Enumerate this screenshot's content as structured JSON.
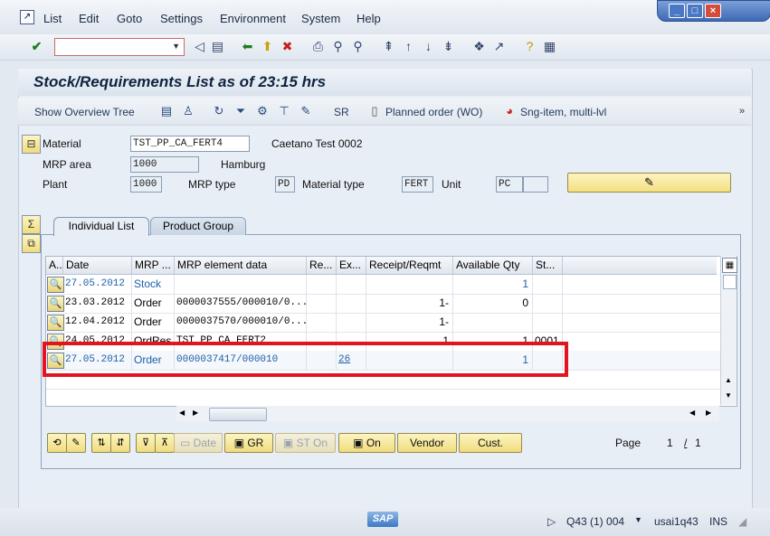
{
  "menu": [
    "List",
    "Edit",
    "Goto",
    "Settings",
    "Environment",
    "System",
    "Help"
  ],
  "menu_underline": [
    "L",
    "E",
    "G",
    "S",
    "n",
    "y",
    "H"
  ],
  "command_field": {
    "value": ""
  },
  "title": "Stock/Requirements List as of 23:15 hrs",
  "app_toolbar": {
    "show_overview": "Show Overview Tree",
    "sr": "SR",
    "planned_order": "Planned order (WO)",
    "sng_item": "Sng-item, multi-lvl"
  },
  "header": {
    "material_label": "Material",
    "material_value": "TST_PP_CA_FERT4",
    "material_desc": "Caetano Test 0002",
    "mrp_area_label": "MRP area",
    "mrp_area_value": "1000",
    "mrp_area_desc": "Hamburg",
    "plant_label": "Plant",
    "plant_value": "1000",
    "mrp_type_label": "MRP type",
    "mrp_type_value": "PD",
    "material_type_label": "Material type",
    "material_type_value": "FERT",
    "unit_label": "Unit",
    "unit_value": "PC",
    "unit_value2": ""
  },
  "tabs": [
    "Individual List",
    "Product Group"
  ],
  "columns": [
    "A..",
    "Date",
    "MRP ...",
    "MRP element data",
    "Re...",
    "Ex...",
    "Receipt/Reqmt",
    "Available Qty",
    "St..."
  ],
  "rows": [
    {
      "date": "27.05.2012",
      "mrp": "Stock",
      "element": "",
      "re": "",
      "ex": "",
      "receipt": "",
      "available": "1",
      "st": ""
    },
    {
      "date": "23.03.2012",
      "mrp": "Order",
      "element": "0000037555/000010/0...",
      "re": "",
      "ex": "",
      "receipt": "1-",
      "available": "0",
      "st": ""
    },
    {
      "date": "12.04.2012",
      "mrp": "Order",
      "element": "0000037570/000010/0...",
      "re": "",
      "ex": "",
      "receipt": "1-",
      "available": "",
      "st": ""
    },
    {
      "date": "24.05.2012",
      "mrp": "OrdRes",
      "element": "TST_PP_CA_FERT2",
      "re": "",
      "ex": "",
      "receipt": "1",
      "available": "1",
      "st": "0001"
    },
    {
      "date": "27.05.2012",
      "mrp": "Order",
      "element": "0000037417/000010",
      "re": "",
      "ex": "26",
      "receipt": "",
      "available": "1",
      "st": ""
    }
  ],
  "bottom_buttons": {
    "date": "Date",
    "gr": "GR",
    "st_on": "ST On",
    "on": "On",
    "vendor": "Vendor",
    "cust": "Cust."
  },
  "paging": {
    "label": "Page",
    "current": "1",
    "sep": "/",
    "total": "1"
  },
  "status": {
    "system": "Q43 (1) 004",
    "server": "usai1q43",
    "mode": "INS",
    "logo": "SAP"
  }
}
